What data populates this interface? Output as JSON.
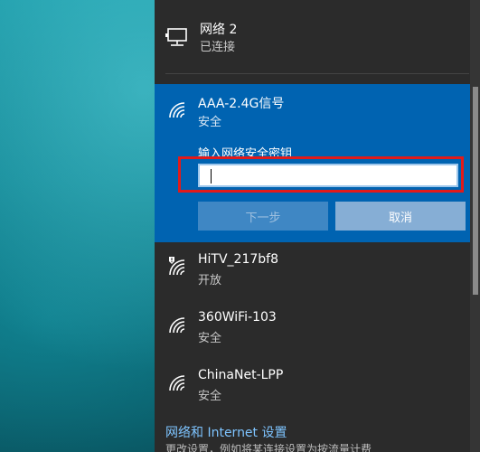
{
  "connected_network": {
    "name": "网络 2",
    "status": "已连接"
  },
  "selected_network": {
    "name": "AAA-2.4G信号",
    "security": "安全",
    "password_label": "输入网络安全密钥",
    "password_value": "",
    "next_label": "下一步",
    "cancel_label": "取消"
  },
  "networks": [
    {
      "name": "HiTV_217bf8",
      "security": "开放"
    },
    {
      "name": "360WiFi-103",
      "security": "安全"
    },
    {
      "name": "ChinaNet-LPP",
      "security": "安全"
    }
  ],
  "footer": {
    "settings_link": "网络和 Internet 设置",
    "description": "更改设置，例如将某连接设置为按流量计费"
  },
  "colors": {
    "selected_bg": "#0063b1",
    "flyout_bg": "#2b2b2b",
    "highlight_frame": "#e21a1a",
    "link": "#7ec4ff"
  }
}
